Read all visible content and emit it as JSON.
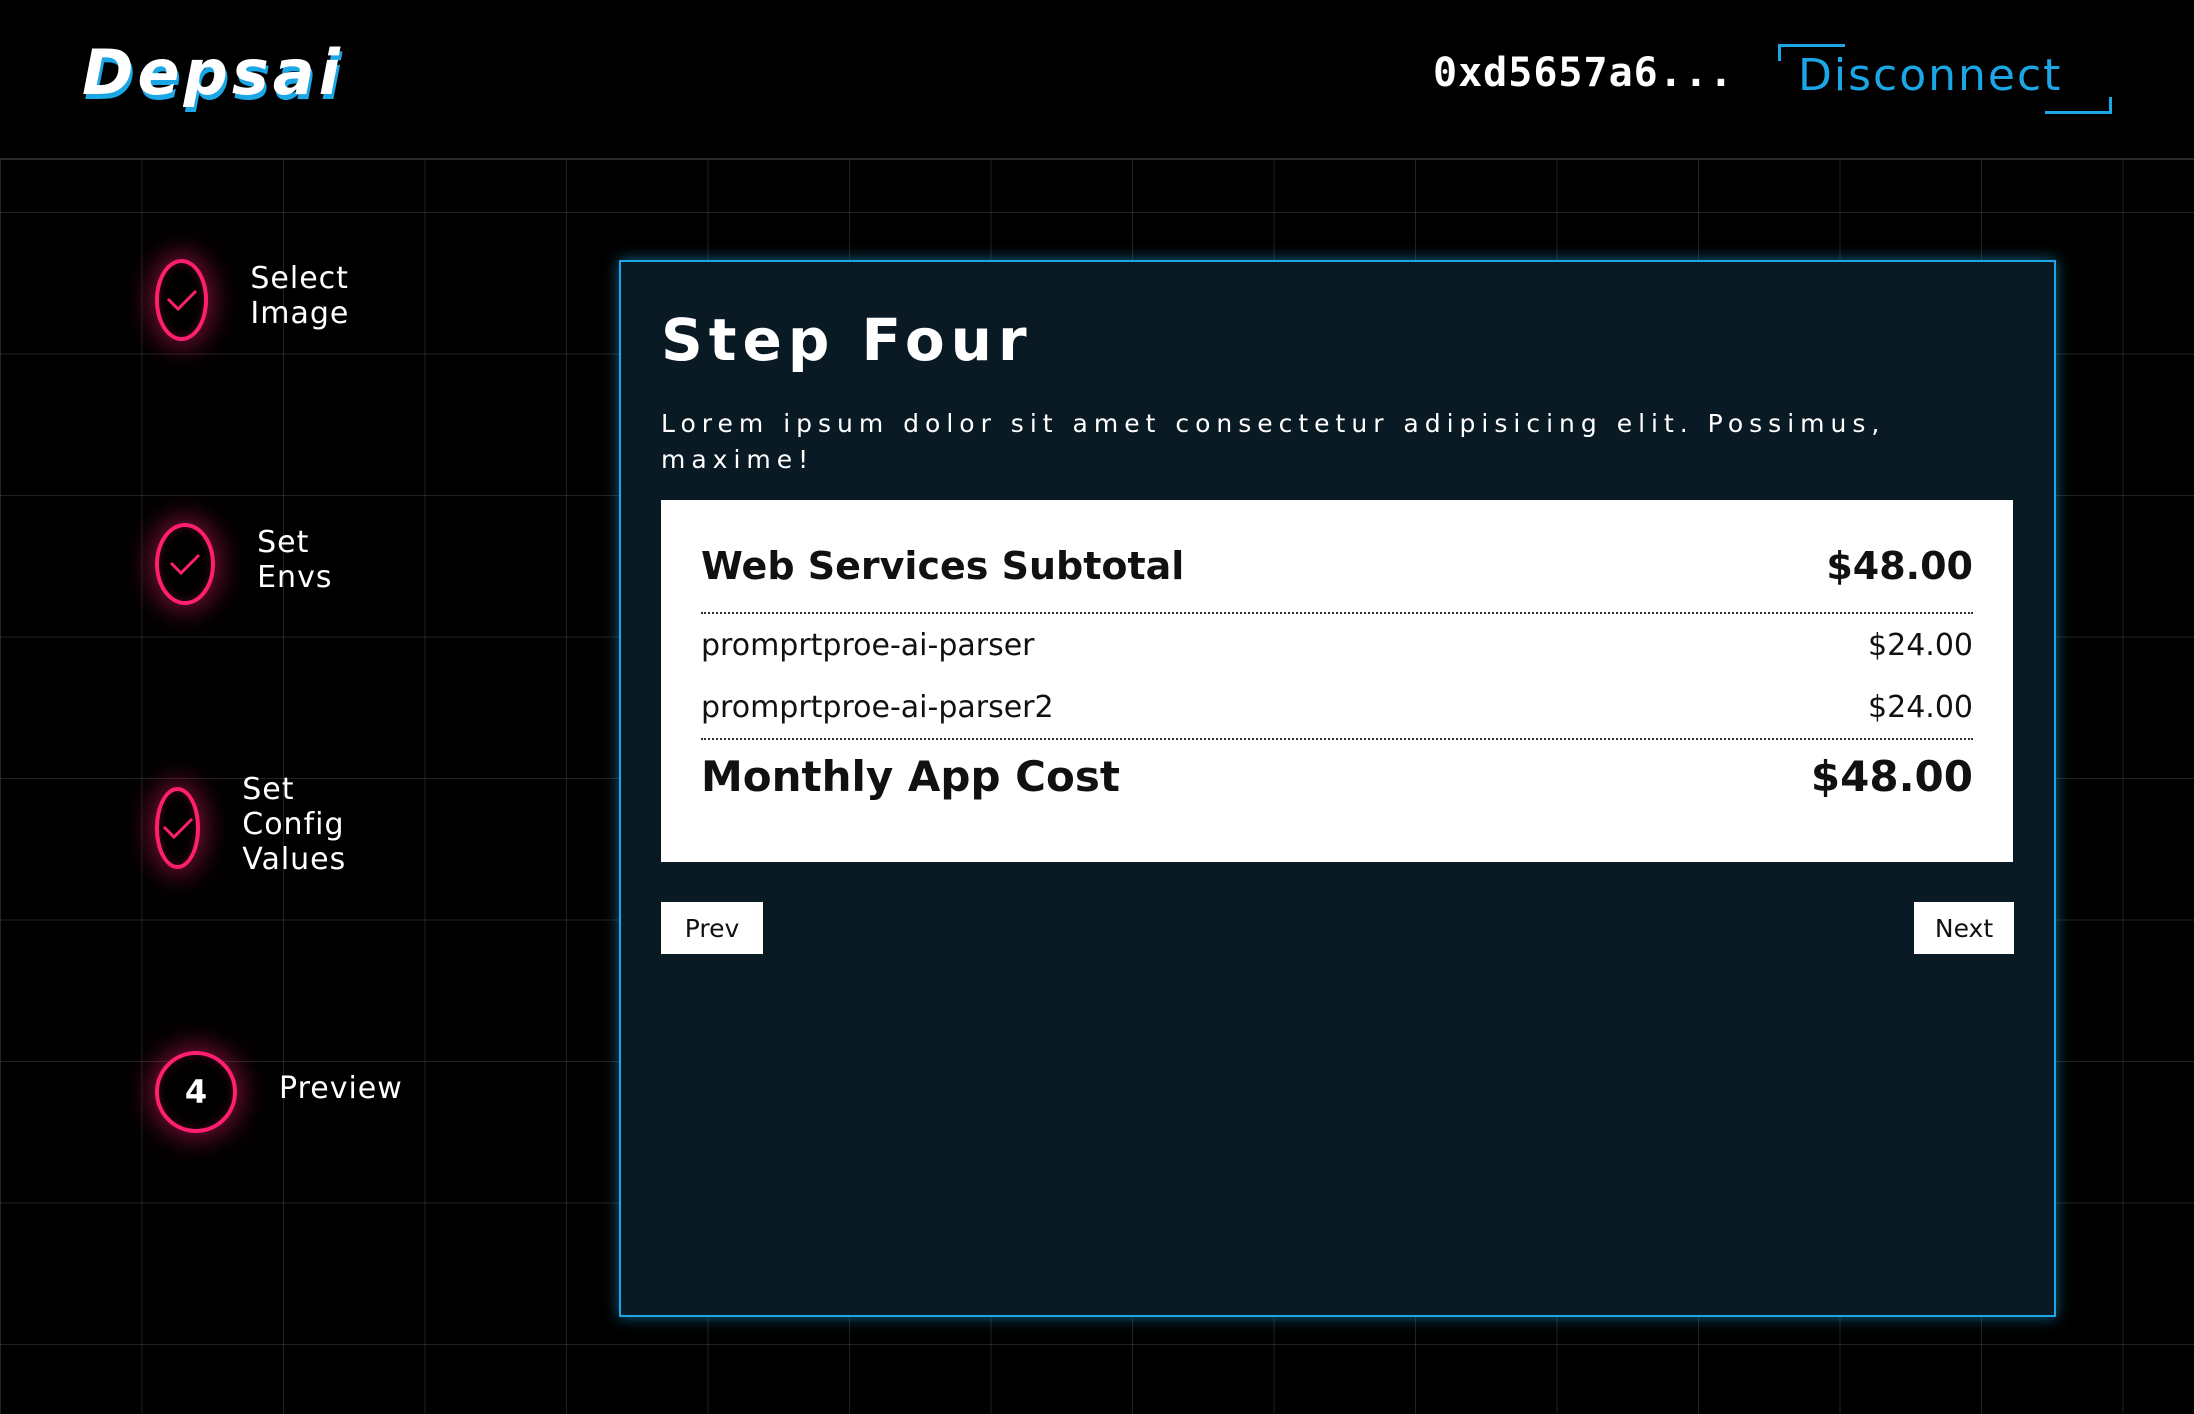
{
  "header": {
    "logo": "Depsai",
    "wallet_address": "0xd5657a6...",
    "disconnect_label": "Disconnect"
  },
  "steps": [
    {
      "label": "Select Image",
      "status": "complete",
      "icon": "check-icon"
    },
    {
      "label": "Set Envs",
      "status": "complete",
      "icon": "check-icon"
    },
    {
      "label": "Set Config Values",
      "status": "complete",
      "icon": "check-icon"
    },
    {
      "label": "Preview",
      "status": "current",
      "number": "4"
    }
  ],
  "panel": {
    "title": "Step Four",
    "description": "Lorem ipsum dolor sit amet consectetur adipisicing elit. Possimus, maxime!",
    "cost": {
      "subtotal_label": "Web Services Subtotal",
      "subtotal_value": "$48.00",
      "items": [
        {
          "name": "promprtproe-ai-parser",
          "price": "$24.00"
        },
        {
          "name": "promprtproe-ai-parser2",
          "price": "$24.00"
        }
      ],
      "total_label": "Monthly App Cost",
      "total_value": "$48.00"
    },
    "prev_label": "Prev",
    "next_label": "Next"
  },
  "colors": {
    "accent_blue": "#1ba7e6",
    "accent_pink": "#ff1f6e",
    "panel_bg": "#0a1a24"
  }
}
